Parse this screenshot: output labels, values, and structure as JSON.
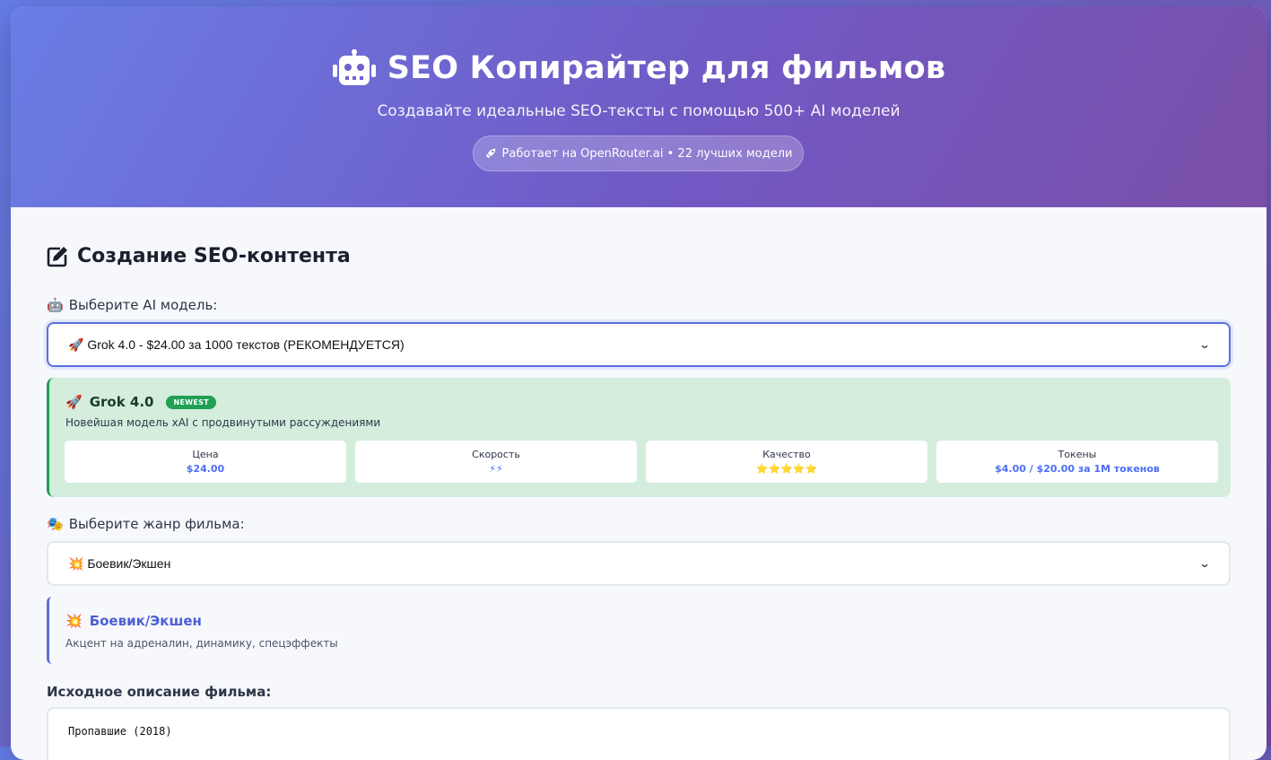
{
  "header": {
    "title": "SEO Копирайтер для фильмов",
    "icon": "robot-icon",
    "subtitle": "Создавайте идеальные SEO-тексты с помощью 500+ AI моделей",
    "pill": "Работает на OpenRouter.ai • 22 лучших модели"
  },
  "section": {
    "title": "Создание SEO-контента"
  },
  "model_select": {
    "label": "Выберите AI модель:",
    "value": "Grok 4.0 - $24.00 за 1000 текстов (РЕКОМЕНДУЕТСЯ)"
  },
  "model_card": {
    "name": "Grok 4.0",
    "badge": "NEWEST",
    "description": "Новейшая модель xAI с продвинутыми рассуждениями",
    "stats": [
      {
        "label": "Цена",
        "value": "$24.00"
      },
      {
        "label": "Скорость",
        "value": "⚡⚡"
      },
      {
        "label": "Качество",
        "value": "⭐⭐⭐⭐⭐"
      },
      {
        "label": "Токены",
        "value": "$4.00 / $20.00 за 1М токенов"
      }
    ]
  },
  "genre_select": {
    "label": "Выберите жанр фильма:",
    "value": "Боевик/Экшен"
  },
  "genre_card": {
    "title": "Боевик/Экшен",
    "description": "Акцент на адреналин, динамику, спецэффекты"
  },
  "description_field": {
    "label": "Исходное описание фильма:",
    "value": "Пропавшие (2018)"
  },
  "colors": {
    "accent": "#667eea",
    "accent_dark": "#764ba2",
    "success": "#1fa053"
  }
}
